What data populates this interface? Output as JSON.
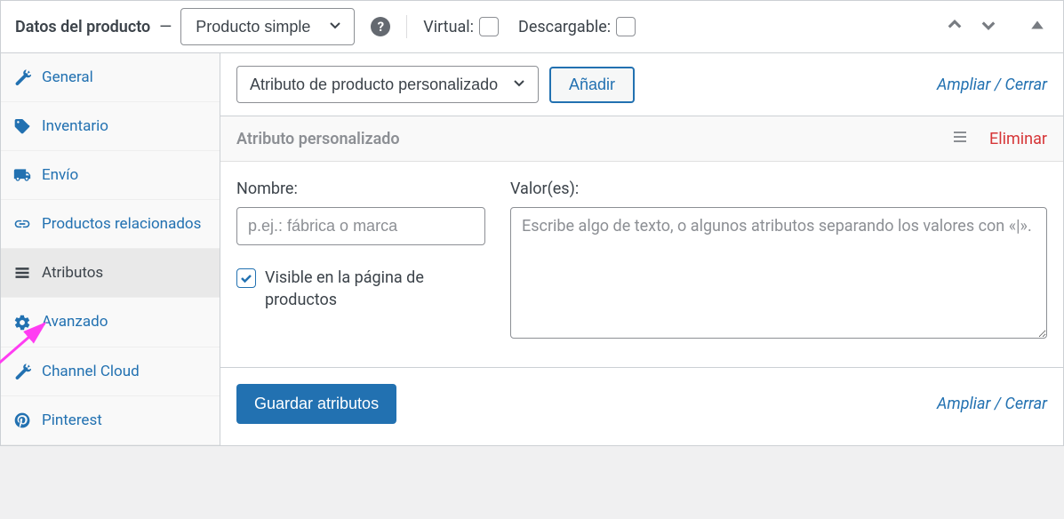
{
  "header": {
    "title": "Datos del producto",
    "dash": "—",
    "product_type_selected": "Producto simple",
    "virtual_label": "Virtual:",
    "downloadable_label": "Descargable:"
  },
  "sidebar": {
    "items": [
      {
        "label": "General",
        "icon": "wrench"
      },
      {
        "label": "Inventario",
        "icon": "tag"
      },
      {
        "label": "Envío",
        "icon": "truck"
      },
      {
        "label": "Productos relacionados",
        "icon": "link"
      },
      {
        "label": "Atributos",
        "icon": "list"
      },
      {
        "label": "Avanzado",
        "icon": "gear"
      },
      {
        "label": "Channel Cloud",
        "icon": "wrench"
      },
      {
        "label": "Pinterest",
        "icon": "pinterest"
      }
    ],
    "active_index": 4
  },
  "toolbar": {
    "attribute_select_value": "Atributo de producto personalizado",
    "add_label": "Añadir",
    "expand_collapse": "Ampliar / Cerrar"
  },
  "attribute": {
    "header_title": "Atributo personalizado",
    "delete_label": "Eliminar",
    "name_label": "Nombre:",
    "name_placeholder": "p.ej.: fábrica o marca",
    "values_label": "Valor(es):",
    "values_placeholder": "Escribe algo de texto, o algunos atributos separando los valores con «|».",
    "visible_checkbox_label": "Visible en la página de productos",
    "visible_checked": true
  },
  "footer": {
    "save_label": "Guardar atributos",
    "expand_collapse": "Ampliar / Cerrar"
  },
  "colors": {
    "accent": "#2271b1",
    "danger": "#d63638"
  }
}
